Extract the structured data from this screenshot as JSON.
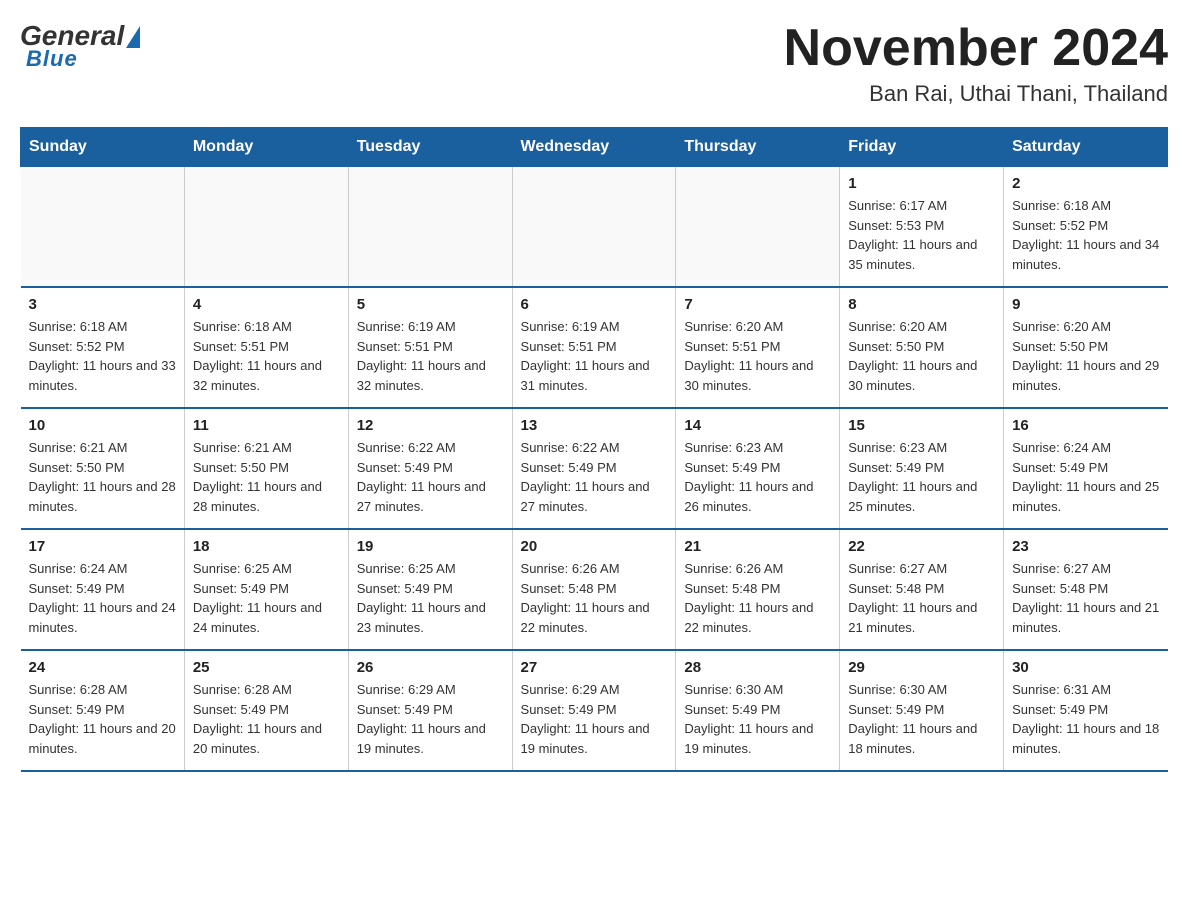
{
  "logo": {
    "general": "General",
    "blue": "Blue",
    "tagline": "Blue"
  },
  "title": "November 2024",
  "location": "Ban Rai, Uthai Thani, Thailand",
  "days_of_week": [
    "Sunday",
    "Monday",
    "Tuesday",
    "Wednesday",
    "Thursday",
    "Friday",
    "Saturday"
  ],
  "weeks": [
    [
      {
        "day": "",
        "info": ""
      },
      {
        "day": "",
        "info": ""
      },
      {
        "day": "",
        "info": ""
      },
      {
        "day": "",
        "info": ""
      },
      {
        "day": "",
        "info": ""
      },
      {
        "day": "1",
        "info": "Sunrise: 6:17 AM\nSunset: 5:53 PM\nDaylight: 11 hours and 35 minutes."
      },
      {
        "day": "2",
        "info": "Sunrise: 6:18 AM\nSunset: 5:52 PM\nDaylight: 11 hours and 34 minutes."
      }
    ],
    [
      {
        "day": "3",
        "info": "Sunrise: 6:18 AM\nSunset: 5:52 PM\nDaylight: 11 hours and 33 minutes."
      },
      {
        "day": "4",
        "info": "Sunrise: 6:18 AM\nSunset: 5:51 PM\nDaylight: 11 hours and 32 minutes."
      },
      {
        "day": "5",
        "info": "Sunrise: 6:19 AM\nSunset: 5:51 PM\nDaylight: 11 hours and 32 minutes."
      },
      {
        "day": "6",
        "info": "Sunrise: 6:19 AM\nSunset: 5:51 PM\nDaylight: 11 hours and 31 minutes."
      },
      {
        "day": "7",
        "info": "Sunrise: 6:20 AM\nSunset: 5:51 PM\nDaylight: 11 hours and 30 minutes."
      },
      {
        "day": "8",
        "info": "Sunrise: 6:20 AM\nSunset: 5:50 PM\nDaylight: 11 hours and 30 minutes."
      },
      {
        "day": "9",
        "info": "Sunrise: 6:20 AM\nSunset: 5:50 PM\nDaylight: 11 hours and 29 minutes."
      }
    ],
    [
      {
        "day": "10",
        "info": "Sunrise: 6:21 AM\nSunset: 5:50 PM\nDaylight: 11 hours and 28 minutes."
      },
      {
        "day": "11",
        "info": "Sunrise: 6:21 AM\nSunset: 5:50 PM\nDaylight: 11 hours and 28 minutes."
      },
      {
        "day": "12",
        "info": "Sunrise: 6:22 AM\nSunset: 5:49 PM\nDaylight: 11 hours and 27 minutes."
      },
      {
        "day": "13",
        "info": "Sunrise: 6:22 AM\nSunset: 5:49 PM\nDaylight: 11 hours and 27 minutes."
      },
      {
        "day": "14",
        "info": "Sunrise: 6:23 AM\nSunset: 5:49 PM\nDaylight: 11 hours and 26 minutes."
      },
      {
        "day": "15",
        "info": "Sunrise: 6:23 AM\nSunset: 5:49 PM\nDaylight: 11 hours and 25 minutes."
      },
      {
        "day": "16",
        "info": "Sunrise: 6:24 AM\nSunset: 5:49 PM\nDaylight: 11 hours and 25 minutes."
      }
    ],
    [
      {
        "day": "17",
        "info": "Sunrise: 6:24 AM\nSunset: 5:49 PM\nDaylight: 11 hours and 24 minutes."
      },
      {
        "day": "18",
        "info": "Sunrise: 6:25 AM\nSunset: 5:49 PM\nDaylight: 11 hours and 24 minutes."
      },
      {
        "day": "19",
        "info": "Sunrise: 6:25 AM\nSunset: 5:49 PM\nDaylight: 11 hours and 23 minutes."
      },
      {
        "day": "20",
        "info": "Sunrise: 6:26 AM\nSunset: 5:48 PM\nDaylight: 11 hours and 22 minutes."
      },
      {
        "day": "21",
        "info": "Sunrise: 6:26 AM\nSunset: 5:48 PM\nDaylight: 11 hours and 22 minutes."
      },
      {
        "day": "22",
        "info": "Sunrise: 6:27 AM\nSunset: 5:48 PM\nDaylight: 11 hours and 21 minutes."
      },
      {
        "day": "23",
        "info": "Sunrise: 6:27 AM\nSunset: 5:48 PM\nDaylight: 11 hours and 21 minutes."
      }
    ],
    [
      {
        "day": "24",
        "info": "Sunrise: 6:28 AM\nSunset: 5:49 PM\nDaylight: 11 hours and 20 minutes."
      },
      {
        "day": "25",
        "info": "Sunrise: 6:28 AM\nSunset: 5:49 PM\nDaylight: 11 hours and 20 minutes."
      },
      {
        "day": "26",
        "info": "Sunrise: 6:29 AM\nSunset: 5:49 PM\nDaylight: 11 hours and 19 minutes."
      },
      {
        "day": "27",
        "info": "Sunrise: 6:29 AM\nSunset: 5:49 PM\nDaylight: 11 hours and 19 minutes."
      },
      {
        "day": "28",
        "info": "Sunrise: 6:30 AM\nSunset: 5:49 PM\nDaylight: 11 hours and 19 minutes."
      },
      {
        "day": "29",
        "info": "Sunrise: 6:30 AM\nSunset: 5:49 PM\nDaylight: 11 hours and 18 minutes."
      },
      {
        "day": "30",
        "info": "Sunrise: 6:31 AM\nSunset: 5:49 PM\nDaylight: 11 hours and 18 minutes."
      }
    ]
  ]
}
